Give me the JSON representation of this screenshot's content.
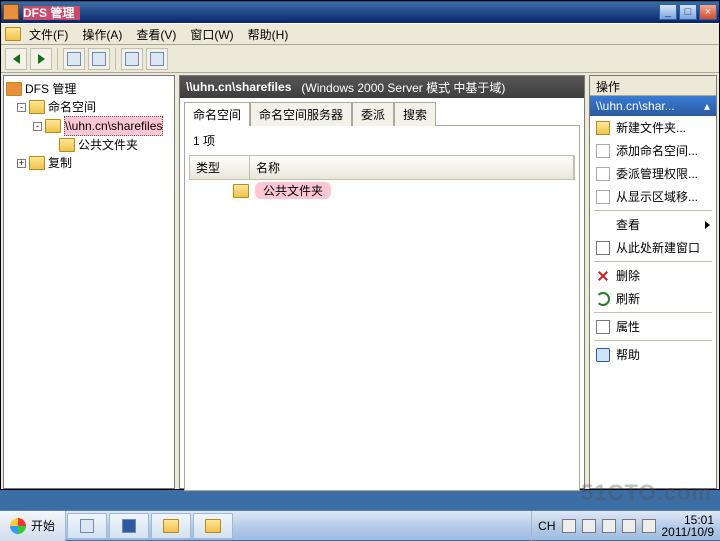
{
  "title": "DFS 管理",
  "menu": {
    "file": "文件(F)",
    "action": "操作(A)",
    "view": "查看(V)",
    "window": "窗口(W)",
    "help": "帮助(H)"
  },
  "tree": {
    "root": "DFS 管理",
    "ns": "命名空间",
    "share": "\\\\uhn.cn\\sharefiles",
    "pub": "公共文件夹",
    "rep": "复制"
  },
  "mid": {
    "path": "\\\\uhn.cn\\sharefiles",
    "mode": "(Windows 2000 Server 模式 中基于域)",
    "tabs": {
      "t1": "命名空间",
      "t2": "命名空间服务器",
      "t3": "委派",
      "t4": "搜索"
    },
    "count": "1 项",
    "cols": {
      "type": "类型",
      "name": "名称"
    },
    "rows": [
      {
        "name": "公共文件夹"
      }
    ]
  },
  "actions": {
    "header": "操作",
    "sel": "\\\\uhn.cn\\shar...",
    "a1": "新建文件夹...",
    "a2": "添加命名空间...",
    "a3": "委派管理权限...",
    "a4": "从显示区域移...",
    "a5": "查看",
    "a6": "从此处新建窗口",
    "a7": "删除",
    "a8": "刷新",
    "a9": "属性",
    "a10": "帮助"
  },
  "taskbar": {
    "start": "开始",
    "lang": "CH",
    "time": "15:01",
    "date": "2011/10/9"
  },
  "watermark": "51CTO.com"
}
